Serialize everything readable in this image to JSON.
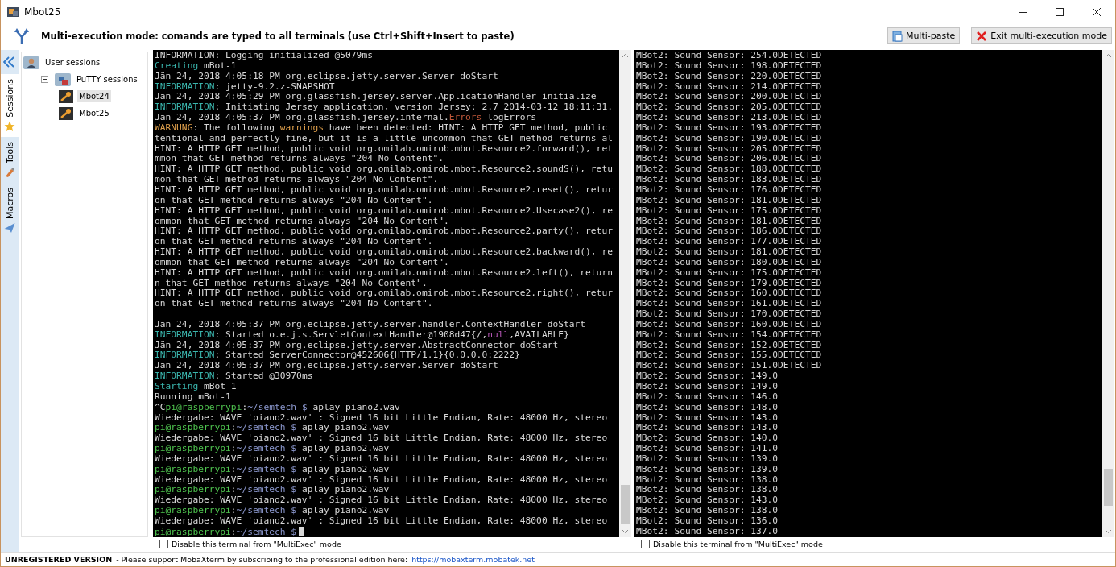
{
  "window": {
    "title": "Mbot25"
  },
  "multiexec_bar": {
    "message": "Multi-execution mode: comands are typed to all terminals (use Ctrl+Shift+Insert to paste)",
    "buttons": [
      {
        "label": "Multi-paste",
        "kind": "paste"
      },
      {
        "label": "Exit multi-execution mode",
        "kind": "exit"
      }
    ]
  },
  "side_tabs": [
    {
      "label": "Sessions",
      "kind": "star",
      "selected": true
    },
    {
      "label": "Tools",
      "kind": "tools",
      "selected": false
    },
    {
      "label": "Macros",
      "kind": "plane",
      "selected": false
    }
  ],
  "sessions_tree": [
    {
      "label": "User sessions",
      "kind": "user-folder",
      "selected": false,
      "children": [
        {
          "label": "PuTTY sessions",
          "kind": "putty-folder",
          "expanded": true,
          "selected": false,
          "children": [
            {
              "label": "Mbot24",
              "kind": "session",
              "selected": true
            },
            {
              "label": "Mbot25",
              "kind": "session",
              "selected": false
            }
          ]
        }
      ]
    }
  ],
  "terminals": [
    {
      "cursor": true,
      "lines": [
        {
          "kind": "plain",
          "text": "INFORMATION: Logging initialized @5079ms"
        },
        {
          "kind": "colored",
          "segments": [
            {
              "text": "Creating",
              "color": "#3ab4ac"
            },
            {
              "text": " mBot-1"
            }
          ]
        },
        {
          "kind": "plain",
          "text": "Jän 24, 2018 4:05:18 PM org.eclipse.jetty.server.Server doStart"
        },
        {
          "kind": "colored",
          "segments": [
            {
              "text": "INFORMATION",
              "color": "#3ab4ac"
            },
            {
              "text": ": jetty-9.2.z-SNAPSHOT"
            }
          ]
        },
        {
          "kind": "plain",
          "text": "Jän 24, 2018 4:05:29 PM org.glassfish.jersey.server.ApplicationHandler initialize"
        },
        {
          "kind": "colored",
          "segments": [
            {
              "text": "INFORMATION",
              "color": "#3ab4ac"
            },
            {
              "text": ": Initiating Jersey application, version Jersey: 2.7 2014-03-12 18:11:31."
            }
          ]
        },
        {
          "kind": "colored",
          "segments": [
            {
              "text": "Jän 24, 2018 4:05:37 PM org.glassfish.jersey.internal."
            },
            {
              "text": "Errors",
              "color": "#c0583a"
            },
            {
              "text": " logErrors"
            }
          ]
        },
        {
          "kind": "colored",
          "segments": [
            {
              "text": "WARNUNG",
              "color": "#e0a04c"
            },
            {
              "text": ": The following "
            },
            {
              "text": "warnings",
              "color": "#e0a04c"
            },
            {
              "text": " have been detected: HINT: A HTTP GET method, public"
            }
          ]
        },
        {
          "kind": "plain",
          "text": "tentional and perfectly fine, but it is a little uncommon that GET method returns al"
        },
        {
          "kind": "plain",
          "text": "HINT: A HTTP GET method, public void org.omilab.omirob.mbot.Resource2.forward(), ret"
        },
        {
          "kind": "plain",
          "text": "mmon that GET method returns always \"204 No Content\"."
        },
        {
          "kind": "plain",
          "text": "HINT: A HTTP GET method, public void org.omilab.omirob.mbot.Resource2.soundS(), retu"
        },
        {
          "kind": "plain",
          "text": "mon that GET method returns always \"204 No Content\"."
        },
        {
          "kind": "plain",
          "text": "HINT: A HTTP GET method, public void org.omilab.omirob.mbot.Resource2.reset(), retur"
        },
        {
          "kind": "plain",
          "text": "on that GET method returns always \"204 No Content\"."
        },
        {
          "kind": "plain",
          "text": "HINT: A HTTP GET method, public void org.omilab.omirob.mbot.Resource2.Usecase2(), re"
        },
        {
          "kind": "plain",
          "text": "ommon that GET method returns always \"204 No Content\"."
        },
        {
          "kind": "plain",
          "text": "HINT: A HTTP GET method, public void org.omilab.omirob.mbot.Resource2.party(), retur"
        },
        {
          "kind": "plain",
          "text": "on that GET method returns always \"204 No Content\"."
        },
        {
          "kind": "plain",
          "text": "HINT: A HTTP GET method, public void org.omilab.omirob.mbot.Resource2.backward(), re"
        },
        {
          "kind": "plain",
          "text": "ommon that GET method returns always \"204 No Content\"."
        },
        {
          "kind": "plain",
          "text": "HINT: A HTTP GET method, public void org.omilab.omirob.mbot.Resource2.left(), return"
        },
        {
          "kind": "plain",
          "text": "n that GET method returns always \"204 No Content\"."
        },
        {
          "kind": "plain",
          "text": "HINT: A HTTP GET method, public void org.omilab.omirob.mbot.Resource2.right(), retur"
        },
        {
          "kind": "plain",
          "text": "on that GET method returns always \"204 No Content\"."
        },
        {
          "kind": "blank"
        },
        {
          "kind": "plain",
          "text": "Jän 24, 2018 4:05:37 PM org.eclipse.jetty.server.handler.ContextHandler doStart"
        },
        {
          "kind": "colored",
          "segments": [
            {
              "text": "INFORMATION",
              "color": "#3ab4ac"
            },
            {
              "text": ": Started o.e.j.s.ServletContextHandler@1908d47{/,"
            },
            {
              "text": "null",
              "color": "#b455b4"
            },
            {
              "text": ",AVAILABLE}"
            }
          ]
        },
        {
          "kind": "plain",
          "text": "Jän 24, 2018 4:05:37 PM org.eclipse.jetty.server.AbstractConnector doStart"
        },
        {
          "kind": "colored",
          "segments": [
            {
              "text": "INFORMATION",
              "color": "#3ab4ac"
            },
            {
              "text": ": Started ServerConnector@452606{HTTP/1.1}{0.0.0.0:2222}"
            }
          ]
        },
        {
          "kind": "plain",
          "text": "Jän 24, 2018 4:05:37 PM org.eclipse.jetty.server.Server doStart"
        },
        {
          "kind": "colored",
          "segments": [
            {
              "text": "INFORMATION",
              "color": "#3ab4ac"
            },
            {
              "text": ": Started @30970ms"
            }
          ]
        },
        {
          "kind": "colored",
          "segments": [
            {
              "text": "Starting",
              "color": "#3ab4ac"
            },
            {
              "text": " mBot-1"
            }
          ]
        },
        {
          "kind": "plain",
          "text": "Running mBot-1"
        },
        {
          "kind": "colored",
          "segments": [
            {
              "text": "^C"
            },
            {
              "text": "pi@raspberrypi",
              "color": "#4ec24e"
            },
            {
              "text": ":"
            },
            {
              "text": "~/semtech $",
              "color": "#8a96cc"
            },
            {
              "text": " aplay piano2.wav"
            }
          ]
        },
        {
          "kind": "plain",
          "text": "Wiedergabe: WAVE 'piano2.wav' : Signed 16 bit Little Endian, Rate: 48000 Hz, stereo"
        },
        {
          "kind": "colored",
          "segments": [
            {
              "text": "pi@raspberrypi",
              "color": "#4ec24e"
            },
            {
              "text": ":"
            },
            {
              "text": "~/semtech $",
              "color": "#8a96cc"
            },
            {
              "text": " aplay piano2.wav"
            }
          ]
        },
        {
          "kind": "plain",
          "text": "Wiedergabe: WAVE 'piano2.wav' : Signed 16 bit Little Endian, Rate: 48000 Hz, stereo"
        },
        {
          "kind": "colored",
          "segments": [
            {
              "text": "pi@raspberrypi",
              "color": "#4ec24e"
            },
            {
              "text": ":"
            },
            {
              "text": "~/semtech $",
              "color": "#8a96cc"
            },
            {
              "text": " aplay piano2.wav"
            }
          ]
        },
        {
          "kind": "plain",
          "text": "Wiedergabe: WAVE 'piano2.wav' : Signed 16 bit Little Endian, Rate: 48000 Hz, stereo"
        },
        {
          "kind": "colored",
          "segments": [
            {
              "text": "pi@raspberrypi",
              "color": "#4ec24e"
            },
            {
              "text": ":"
            },
            {
              "text": "~/semtech $",
              "color": "#8a96cc"
            },
            {
              "text": " aplay piano2.wav"
            }
          ]
        },
        {
          "kind": "plain",
          "text": "Wiedergabe: WAVE 'piano2.wav' : Signed 16 bit Little Endian, Rate: 48000 Hz, stereo"
        },
        {
          "kind": "colored",
          "segments": [
            {
              "text": "pi@raspberrypi",
              "color": "#4ec24e"
            },
            {
              "text": ":"
            },
            {
              "text": "~/semtech $",
              "color": "#8a96cc"
            },
            {
              "text": " aplay piano2.wav"
            }
          ]
        },
        {
          "kind": "plain",
          "text": "Wiedergabe: WAVE 'piano2.wav' : Signed 16 bit Little Endian, Rate: 48000 Hz, stereo"
        },
        {
          "kind": "colored",
          "segments": [
            {
              "text": "pi@raspberrypi",
              "color": "#4ec24e"
            },
            {
              "text": ":"
            },
            {
              "text": "~/semtech $",
              "color": "#8a96cc"
            },
            {
              "text": " aplay piano2.wav"
            }
          ]
        },
        {
          "kind": "plain",
          "text": "Wiedergabe: WAVE 'piano2.wav' : Signed 16 bit Little Endian, Rate: 48000 Hz, stereo"
        },
        {
          "kind": "colored",
          "segments": [
            {
              "text": "pi@raspberrypi",
              "color": "#4ec24e"
            },
            {
              "text": ":"
            },
            {
              "text": "~/semtech $",
              "color": "#8a96cc"
            }
          ]
        }
      ],
      "disable_option": {
        "label": "Disable this terminal from \"MultiExec\" mode",
        "checked": false
      }
    },
    {
      "lines": [
        {
          "kind": "plain",
          "text": "MBot2: Sound Sensor: 254.0DETECTED"
        },
        {
          "kind": "plain",
          "text": "MBot2: Sound Sensor: 198.0DETECTED"
        },
        {
          "kind": "plain",
          "text": "MBot2: Sound Sensor: 220.0DETECTED"
        },
        {
          "kind": "plain",
          "text": "MBot2: Sound Sensor: 214.0DETECTED"
        },
        {
          "kind": "plain",
          "text": "MBot2: Sound Sensor: 200.0DETECTED"
        },
        {
          "kind": "plain",
          "text": "MBot2: Sound Sensor: 205.0DETECTED"
        },
        {
          "kind": "plain",
          "text": "MBot2: Sound Sensor: 213.0DETECTED"
        },
        {
          "kind": "plain",
          "text": "MBot2: Sound Sensor: 193.0DETECTED"
        },
        {
          "kind": "plain",
          "text": "MBot2: Sound Sensor: 190.0DETECTED"
        },
        {
          "kind": "plain",
          "text": "MBot2: Sound Sensor: 205.0DETECTED"
        },
        {
          "kind": "plain",
          "text": "MBot2: Sound Sensor: 206.0DETECTED"
        },
        {
          "kind": "plain",
          "text": "MBot2: Sound Sensor: 188.0DETECTED"
        },
        {
          "kind": "plain",
          "text": "MBot2: Sound Sensor: 183.0DETECTED"
        },
        {
          "kind": "plain",
          "text": "MBot2: Sound Sensor: 176.0DETECTED"
        },
        {
          "kind": "plain",
          "text": "MBot2: Sound Sensor: 181.0DETECTED"
        },
        {
          "kind": "plain",
          "text": "MBot2: Sound Sensor: 175.0DETECTED"
        },
        {
          "kind": "plain",
          "text": "MBot2: Sound Sensor: 181.0DETECTED"
        },
        {
          "kind": "plain",
          "text": "MBot2: Sound Sensor: 186.0DETECTED"
        },
        {
          "kind": "plain",
          "text": "MBot2: Sound Sensor: 177.0DETECTED"
        },
        {
          "kind": "plain",
          "text": "MBot2: Sound Sensor: 181.0DETECTED"
        },
        {
          "kind": "plain",
          "text": "MBot2: Sound Sensor: 180.0DETECTED"
        },
        {
          "kind": "plain",
          "text": "MBot2: Sound Sensor: 175.0DETECTED"
        },
        {
          "kind": "plain",
          "text": "MBot2: Sound Sensor: 179.0DETECTED"
        },
        {
          "kind": "plain",
          "text": "MBot2: Sound Sensor: 160.0DETECTED"
        },
        {
          "kind": "plain",
          "text": "MBot2: Sound Sensor: 161.0DETECTED"
        },
        {
          "kind": "plain",
          "text": "MBot2: Sound Sensor: 170.0DETECTED"
        },
        {
          "kind": "plain",
          "text": "MBot2: Sound Sensor: 160.0DETECTED"
        },
        {
          "kind": "plain",
          "text": "MBot2: Sound Sensor: 154.0DETECTED"
        },
        {
          "kind": "plain",
          "text": "MBot2: Sound Sensor: 152.0DETECTED"
        },
        {
          "kind": "plain",
          "text": "MBot2: Sound Sensor: 155.0DETECTED"
        },
        {
          "kind": "plain",
          "text": "MBot2: Sound Sensor: 151.0DETECTED"
        },
        {
          "kind": "plain",
          "text": "MBot2: Sound Sensor: 149.0"
        },
        {
          "kind": "plain",
          "text": "MBot2: Sound Sensor: 149.0"
        },
        {
          "kind": "plain",
          "text": "MBot2: Sound Sensor: 146.0"
        },
        {
          "kind": "plain",
          "text": "MBot2: Sound Sensor: 148.0"
        },
        {
          "kind": "plain",
          "text": "MBot2: Sound Sensor: 143.0"
        },
        {
          "kind": "plain",
          "text": "MBot2: Sound Sensor: 143.0"
        },
        {
          "kind": "plain",
          "text": "MBot2: Sound Sensor: 140.0"
        },
        {
          "kind": "plain",
          "text": "MBot2: Sound Sensor: 141.0"
        },
        {
          "kind": "plain",
          "text": "MBot2: Sound Sensor: 139.0"
        },
        {
          "kind": "plain",
          "text": "MBot2: Sound Sensor: 139.0"
        },
        {
          "kind": "plain",
          "text": "MBot2: Sound Sensor: 138.0"
        },
        {
          "kind": "plain",
          "text": "MBot2: Sound Sensor: 138.0"
        },
        {
          "kind": "plain",
          "text": "MBot2: Sound Sensor: 143.0"
        },
        {
          "kind": "plain",
          "text": "MBot2: Sound Sensor: 138.0"
        },
        {
          "kind": "plain",
          "text": "MBot2: Sound Sensor: 136.0"
        },
        {
          "kind": "plain",
          "text": "MBot2: Sound Sensor: 137.0"
        }
      ],
      "disable_option": {
        "label": "Disable this terminal from \"MultiExec\" mode",
        "checked": false
      }
    }
  ],
  "status_bar": {
    "label": "UNREGISTERED VERSION",
    "message": "- Please support MobaXterm by subscribing to the professional edition here:",
    "link": "https://mobaxterm.mobatek.net"
  }
}
